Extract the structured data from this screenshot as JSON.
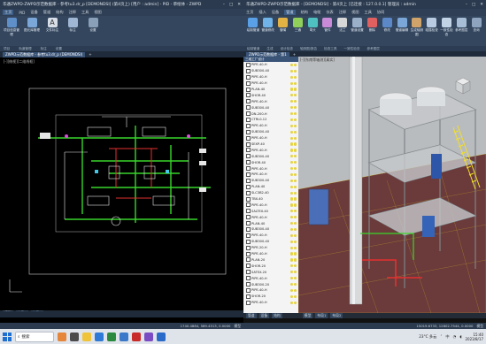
{
  "left_window": {
    "title": "华通ZWPD-ZWPD示范数据库 - 参考tu3.dr_p [DEMONDSI] (第4页上) [用户 : admin] - PID - 草绘体 - ZWPD",
    "menu": [
      "主页",
      "PID",
      "设备",
      "管道",
      "结构",
      "注释",
      "工具",
      "视图"
    ],
    "ribbon_buttons": [
      "项目信息管理",
      "图元库管理",
      "文件标注",
      "标注",
      "设置"
    ],
    "ribbon_groups": [
      "项目",
      "轨道管理",
      "标注",
      "设置"
    ],
    "doc_tab": "ZWPD示范数据库 - 参考tu3.dr_p (DEMONDSI)",
    "view_label": "[-][俯视][二维线框]",
    "layout_tabs": [
      "模型",
      "布局1",
      "布局2"
    ],
    "coords": "1740.4884, 589.4513, 0.0000",
    "status_right": "模型"
  },
  "right_window": {
    "title": "华通ZWPD-ZWPD示范数据库 - [DEMONDSI] - 第4页上 [已连接 : 127.0.0.1] 管理员 : admin",
    "menu": [
      "主页",
      "插入",
      "设备",
      "管道",
      "结构",
      "电缆",
      "仪表",
      "注释",
      "视图",
      "工具",
      "协同"
    ],
    "ribbon_buttons": [
      "绘制管道",
      "管道修改",
      "管嘴",
      "三通",
      "弯头",
      "管件",
      "法兰",
      "管道设置",
      "删除",
      "修改",
      "管道编辑",
      "生成轴测图",
      "碰撞检查",
      "一致性检查",
      "参考图层",
      "查询"
    ],
    "ribbon_groups": [
      "绘制管道",
      "生成",
      "设计检查",
      "轴测图/报告",
      "检查工具",
      "一致性检查",
      "参考图层"
    ],
    "doc_tab": "ZWPD示范数据库 - 第1",
    "view_label": "[-][东南等轴测][真实]",
    "tree_header": "三维工厂设计",
    "tree_items": [
      "PIPE-40-H",
      "SUB300-40",
      "PIPE-40-H",
      "PIPE-40-H",
      "PLAN-40",
      "SHOR-40",
      "PIPE-40-H",
      "SUB300-40",
      "DN-200-H",
      "CTRL0-12",
      "PIPE-40-H",
      "SUB300-40",
      "PIPE-40-H",
      "SEXP-40",
      "PIPE-40-H",
      "SUB300-40",
      "SHOR-40",
      "PIPE-40-H",
      "PIPE-40-H",
      "SUB300-40",
      "PLAN-40",
      "SLC3B2-40",
      "TBX-40",
      "PIPE-40-H",
      "SALTEX-40",
      "PIPE-40-H",
      "PLAN-40",
      "SUB300-40",
      "PIPE-40-H",
      "SUB300-40",
      "PIPE-20-H",
      "PIPE-40-H",
      "PLAN-20",
      "SHOR-20",
      "SATEX-20",
      "PIPE-40-H",
      "SUB300-20",
      "PIPE-40-H",
      "SHOR-20",
      "PIPE-40-H"
    ],
    "tree_footer_tabs": [
      "管道",
      "设备",
      "结构"
    ],
    "layout_tabs": [
      "模型",
      "布局1",
      "布局2"
    ],
    "coords": "15019.6733, 12802.7544, 0.0000",
    "status_right": "模型"
  },
  "taskbar": {
    "search_placeholder": "搜索",
    "weather": "23°C 多云",
    "time": "15:40",
    "date": "2023/8/17",
    "ime": "中"
  },
  "colors": {
    "ribbon": "#33465e",
    "titlebar": "#2b3a4e",
    "pipe_green": "#38d62a",
    "pipe_red": "#e43030",
    "pipe_yellow": "#f2df2a"
  }
}
